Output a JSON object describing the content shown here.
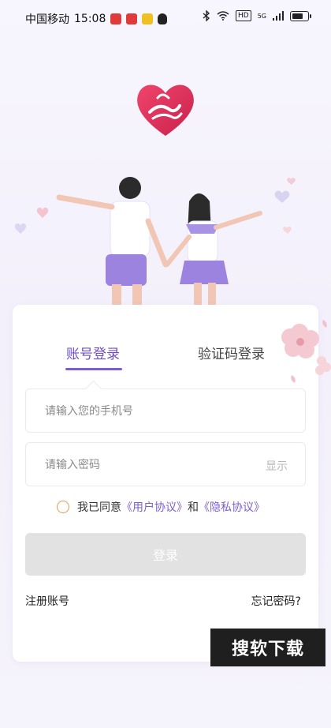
{
  "status_bar": {
    "carrier": "中国移动",
    "time": "15:08",
    "hd": "HD",
    "network": "5G",
    "battery_level": 0.8
  },
  "tabs": {
    "account_login": "账号登录",
    "sms_login": "验证码登录",
    "active": "account_login"
  },
  "form": {
    "phone_placeholder": "请输入您的手机号",
    "phone_value": "",
    "password_placeholder": "请输入密码",
    "password_value": "",
    "show_label": "显示"
  },
  "agreement": {
    "prefix": "我已同意",
    "user_agreement": "《用户协议》",
    "and": "和",
    "privacy_agreement": "《隐私协议》",
    "checked": false
  },
  "buttons": {
    "login": "登录",
    "register": "注册账号",
    "forgot_password": "忘记密码?"
  },
  "watermark": "搜软下载",
  "colors": {
    "accent": "#7a5cd6",
    "logo_red": "#e0345e",
    "disabled_button": "#e2e2e2"
  }
}
